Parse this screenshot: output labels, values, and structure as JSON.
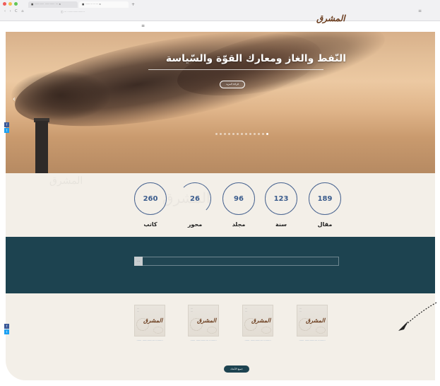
{
  "browser": {
    "tabs": [
      "■ ⋯⋯⋯⋯ ⋯⋯⋯⋯ ⋯ ×",
      "■ ⋯⋯⋯ ⋯⋯ ×"
    ],
    "new_tab": "+",
    "nav": "‹ › C ⌂",
    "url": "ⓘ ⋯ ⋯⋯⋯⋯⋯⋯⋯",
    "menu": "≡"
  },
  "site": {
    "logo": "المشرق",
    "logo_sub": "",
    "menu_icon": "≡"
  },
  "hero": {
    "title": "النّفط والغاز ومعارك القوّة والسّياسة",
    "subtitle": "",
    "button": "قراءة المزيد",
    "prev_arrow": "‹",
    "slide_count": 13,
    "active_slide": 12
  },
  "social": {
    "facebook": "f",
    "twitter": "t"
  },
  "stats": {
    "faded_text": "المشرق",
    "items": [
      {
        "value": "260",
        "label": "كاتب"
      },
      {
        "value": "26",
        "label": "محور"
      },
      {
        "value": "96",
        "label": "مجلد"
      },
      {
        "value": "123",
        "label": "سنة"
      },
      {
        "value": "189",
        "label": "مقال"
      }
    ]
  },
  "search": {
    "button": "⋯"
  },
  "issues": {
    "items": [
      {
        "caption": "⋯⋯⋯ ⋯⋯⋯⋯⋯ ⋯⋯",
        "number": "⋯\n⋯"
      },
      {
        "caption": "⋯⋯⋯ ⋯⋯⋯⋯⋯ ⋯⋯",
        "number": "⋯\n⋯"
      },
      {
        "caption": "⋯⋯⋯ ⋯⋯⋯⋯⋯ ⋯⋯",
        "number": "⋯\n⋯"
      },
      {
        "caption": "⋯⋯⋯ ⋯⋯⋯⋯⋯ ⋯⋯",
        "number": "⋯\n⋯"
      }
    ],
    "cover_logo": "المشرق",
    "all_button": "جميع الأعداد"
  },
  "colors": {
    "accent": "#3b5c8d",
    "band": "#1d4350",
    "cream": "#f3efe8",
    "logo": "#6b3d1e"
  }
}
